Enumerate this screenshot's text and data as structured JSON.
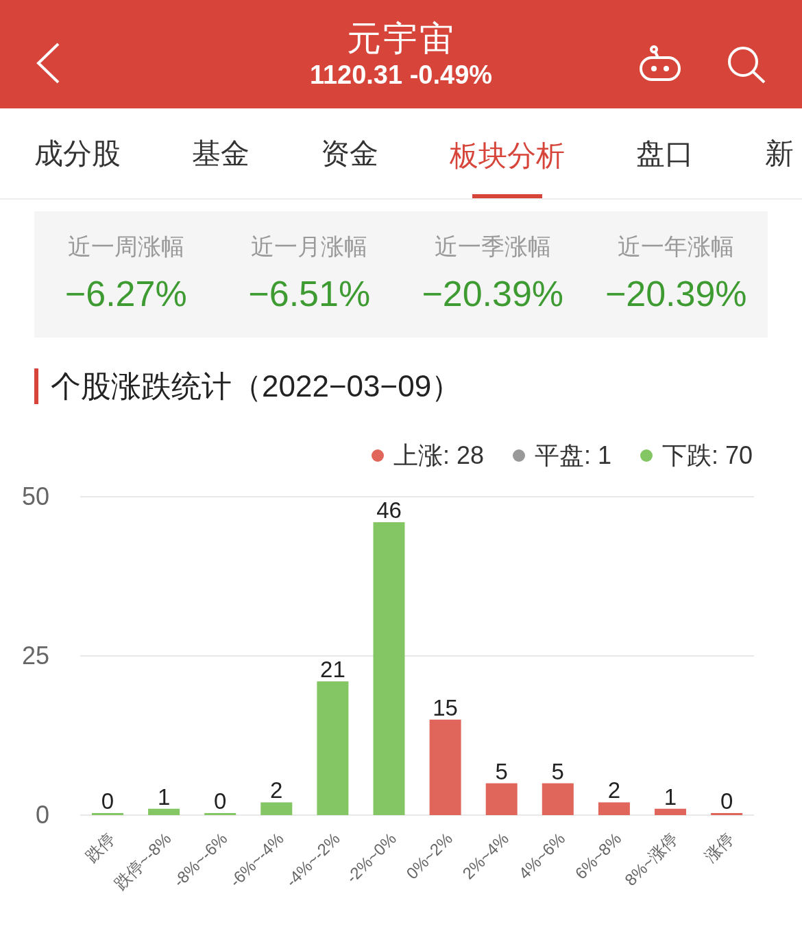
{
  "header": {
    "title": "元宇宙",
    "subtitle": "1120.31 -0.49%"
  },
  "tabs": [
    {
      "label": "成分股",
      "selected": false
    },
    {
      "label": "基金",
      "selected": false
    },
    {
      "label": "资金",
      "selected": false
    },
    {
      "label": "板块分析",
      "selected": true
    },
    {
      "label": "盘口",
      "selected": false
    },
    {
      "label": "新",
      "selected": false
    }
  ],
  "stats": [
    {
      "label": "近一周涨幅",
      "value": "−6.27%"
    },
    {
      "label": "近一月涨幅",
      "value": "−6.51%"
    },
    {
      "label": "近一季涨幅",
      "value": "−20.39%"
    },
    {
      "label": "近一年涨幅",
      "value": "−20.39%"
    }
  ],
  "section_title": "个股涨跌统计（2022−03−09）",
  "legend": [
    {
      "label": "上涨: 28",
      "color": "#e0665b"
    },
    {
      "label": "平盘: 1",
      "color": "#999999"
    },
    {
      "label": "下跌: 70",
      "color": "#84c564"
    }
  ],
  "chart_data": {
    "type": "bar",
    "categories": [
      "跌停",
      "跌停~-8%",
      "-8%~-6%",
      "-6%~-4%",
      "-4%~-2%",
      "-2%~0%",
      "0%~2%",
      "2%~4%",
      "4%~6%",
      "6%~8%",
      "8%~涨停",
      "涨停"
    ],
    "series": [
      {
        "color": "#84c564",
        "values": [
          0,
          1,
          0,
          2,
          21,
          46,
          null,
          null,
          null,
          null,
          null,
          null
        ]
      },
      {
        "color": "#e0665b",
        "values": [
          null,
          null,
          null,
          null,
          null,
          null,
          15,
          5,
          5,
          2,
          1,
          0
        ]
      }
    ],
    "ylim": [
      0,
      50
    ],
    "yticks": [
      0,
      25,
      50
    ],
    "data_labels": true
  }
}
